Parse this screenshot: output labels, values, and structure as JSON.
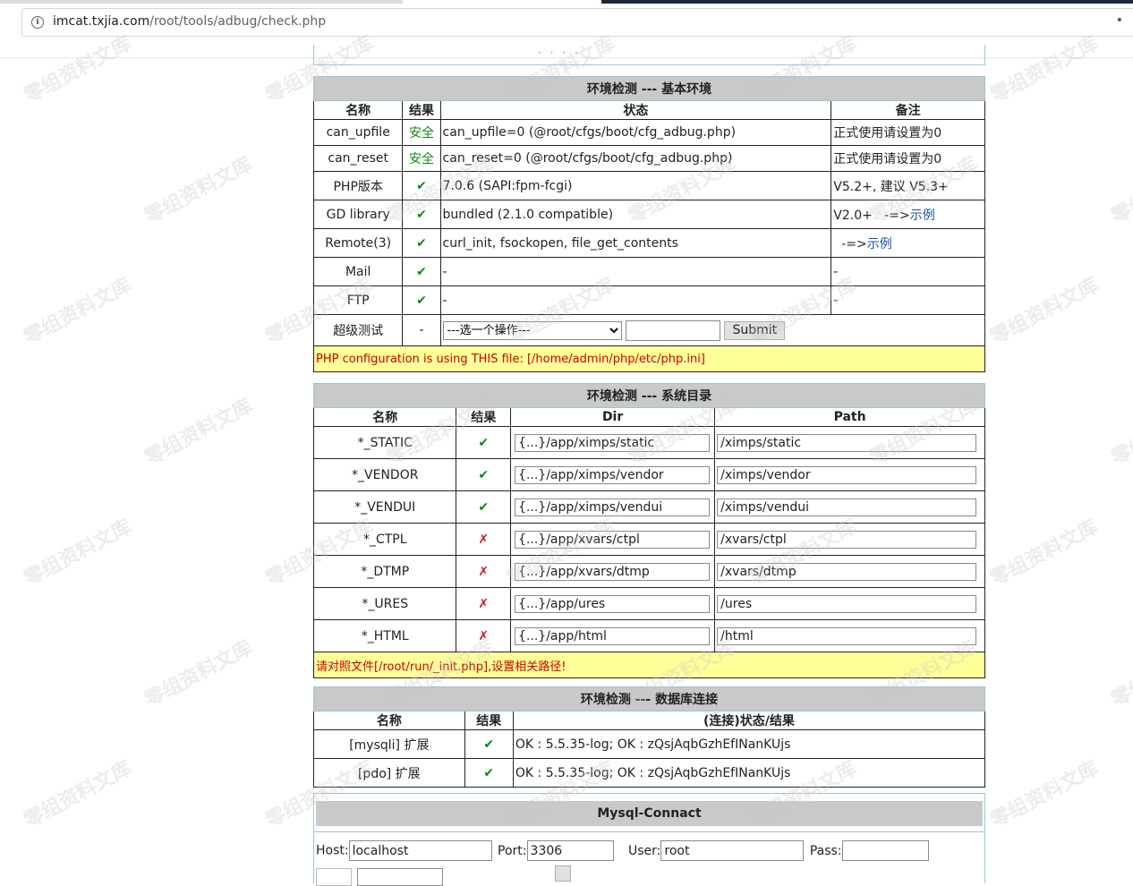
{
  "browser": {
    "url_host": "imcat.txjia.com",
    "url_path": "/root/tools/adbug/check.php"
  },
  "basic": {
    "title": "环境检测 --- 基本环境",
    "headers": [
      "名称",
      "结果",
      "状态",
      "备注"
    ],
    "rows": [
      {
        "name": "can_upfile",
        "result": "安全",
        "status": "can_upfile=0 (@root/cfgs/boot/cfg_adbug.php)",
        "note": "正式使用请设置为0",
        "link": ""
      },
      {
        "name": "can_reset",
        "result": "安全",
        "status": "can_reset=0 (@root/cfgs/boot/cfg_adbug.php)",
        "note": "正式使用请设置为0",
        "link": ""
      },
      {
        "name": "PHP版本",
        "result": "✔",
        "status": "7.0.6 (SAPI:fpm-fcgi)",
        "note": "V5.2+, 建议 V5.3+",
        "link": ""
      },
      {
        "name": "GD library",
        "result": "✔",
        "status": "bundled (2.1.0 compatible)",
        "note": "V2.0+   -=>",
        "link": "示例"
      },
      {
        "name": "Remote(3)",
        "result": "✔",
        "status": "curl_init, fsockopen, file_get_contents",
        "note": "  -=>",
        "link": "示例"
      },
      {
        "name": "Mail",
        "result": "✔",
        "status": "-",
        "note": "-",
        "link": ""
      },
      {
        "name": "FTP",
        "result": "✔",
        "status": "-",
        "note": "-",
        "link": ""
      }
    ],
    "super_test": {
      "name": "超级测试",
      "result": "-",
      "select_value": "---选一个操作---",
      "input_value": "",
      "submit_label": "Submit"
    },
    "footer_note": "PHP configuration is using THIS file: [/home/admin/php/etc/php.ini]"
  },
  "dirs": {
    "title": "环境检测 --- 系统目录",
    "headers": [
      "名称",
      "结果",
      "Dir",
      "Path"
    ],
    "rows": [
      {
        "name": "*_STATIC",
        "result": "✔",
        "status": "ok",
        "dir": "{...}/app/ximps/static",
        "path": "/ximps/static"
      },
      {
        "name": "*_VENDOR",
        "result": "✔",
        "status": "ok",
        "dir": "{...}/app/ximps/vendor",
        "path": "/ximps/vendor"
      },
      {
        "name": "*_VENDUI",
        "result": "✔",
        "status": "ok",
        "dir": "{...}/app/ximps/vendui",
        "path": "/ximps/vendui"
      },
      {
        "name": "*_CTPL",
        "result": "✗",
        "status": "bad",
        "dir": "{...}/app/xvars/ctpl",
        "path": "/xvars/ctpl"
      },
      {
        "name": "*_DTMP",
        "result": "✗",
        "status": "bad",
        "dir": "{...}/app/xvars/dtmp",
        "path": "/xvars/dtmp"
      },
      {
        "name": "*_URES",
        "result": "✗",
        "status": "bad",
        "dir": "{...}/app/ures",
        "path": "/ures"
      },
      {
        "name": "*_HTML",
        "result": "✗",
        "status": "bad",
        "dir": "{...}/app/html",
        "path": "/html"
      }
    ],
    "footer_note": "请对照文件[/root/run/_init.php],设置相关路径!"
  },
  "db": {
    "title": "环境检测 --- 数据库连接",
    "headers": [
      "名称",
      "结果",
      "(连接)状态/结果"
    ],
    "rows": [
      {
        "name": "[mysqli] 扩展",
        "result": "✔",
        "status": "OK : 5.5.35-log; OK : zQsjAqbGzhEfINanKUjs"
      },
      {
        "name": "[pdo] 扩展",
        "result": "✔",
        "status": "OK : 5.5.35-log; OK : zQsjAqbGzhEfINanKUjs"
      }
    ]
  },
  "mysql": {
    "title": "Mysql-Connact",
    "host_label": "Host:",
    "host_value": "localhost",
    "port_label": "Port:",
    "port_value": "3306",
    "user_label": "User:",
    "user_value": "root",
    "pass_label": "Pass:",
    "pass_value": ""
  },
  "watermark": "零组资料文库",
  "colors": {
    "ok": "#118811",
    "bad": "#e01010",
    "note_bg": "#ffff99",
    "header_bg": "#c9c9c9"
  }
}
